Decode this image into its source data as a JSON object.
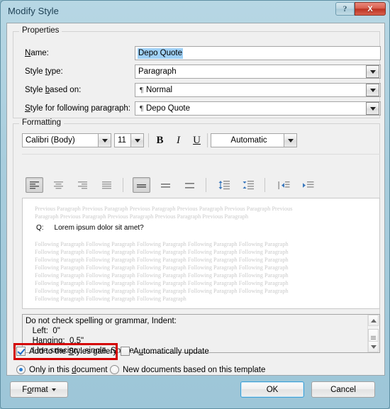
{
  "window": {
    "title": "Modify Style",
    "help_label": "?",
    "close_label": "X"
  },
  "properties": {
    "group_title": "Properties",
    "name_label": "Name:",
    "name_value": "Depo Quote",
    "style_type_label": "Style type:",
    "style_type_value": "Paragraph",
    "style_based_on_label": "Style based on:",
    "style_based_on_value": "Normal",
    "style_following_label": "Style for following paragraph:",
    "style_following_value": "Depo Quote",
    "pilcrow": "¶"
  },
  "formatting": {
    "group_title": "Formatting",
    "font_family": "Calibri (Body)",
    "font_size": "11",
    "bold_label": "B",
    "italic_label": "I",
    "underline_label": "U",
    "font_color": "Automatic",
    "align_left": "≡",
    "align_center": "≡",
    "align_right": "≡",
    "align_justify": "≡",
    "spacing_single": "≡",
    "spacing_onehalf": "≡",
    "spacing_double": "≡",
    "line_spacing_increase": "line-spacing-increase",
    "line_spacing_decrease": "line-spacing-decrease",
    "indent_decrease": "decrease-indent",
    "indent_increase": "increase-indent"
  },
  "preview": {
    "previous_lines": [
      "Previous Paragraph Previous Paragraph Previous Paragraph Previous Paragraph Previous Paragraph Previous",
      "Paragraph Previous Paragraph Previous Paragraph Previous Paragraph Previous Paragraph"
    ],
    "sample_text": "Q:  Lorem ipsum dolor sit amet?",
    "following_lines": [
      "Following Paragraph Following Paragraph Following Paragraph Following Paragraph Following Paragraph",
      "Following Paragraph Following Paragraph Following Paragraph Following Paragraph Following Paragraph",
      "Following Paragraph Following Paragraph Following Paragraph Following Paragraph Following Paragraph",
      "Following Paragraph Following Paragraph Following Paragraph Following Paragraph Following Paragraph",
      "Following Paragraph Following Paragraph Following Paragraph Following Paragraph Following Paragraph",
      "Following Paragraph Following Paragraph Following Paragraph Following Paragraph Following Paragraph",
      "Following Paragraph Following Paragraph Following Paragraph Following Paragraph Following Paragraph",
      "Following Paragraph Following Paragraph Following Paragraph"
    ]
  },
  "description": {
    "text": "Do not check spelling or grammar, Indent:\n   Left:  0\"\n   Hanging:  0.5\"\n   Line spacing:  single, Space"
  },
  "options": {
    "add_gallery_label": "Add to the Styles gallery",
    "add_gallery_checked": true,
    "auto_update_label": "Automatically update",
    "auto_update_checked": false,
    "only_document_label": "Only in this document",
    "only_document_selected": true,
    "new_documents_label": "New documents based on this template",
    "new_documents_selected": false,
    "highlight_color": "#d40000"
  },
  "footer": {
    "format_label": "Format",
    "ok_label": "OK",
    "cancel_label": "Cancel"
  }
}
